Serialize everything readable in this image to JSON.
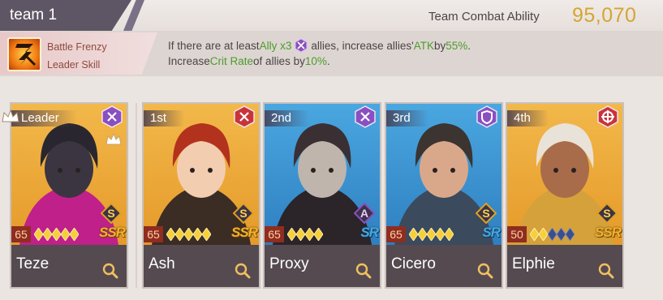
{
  "header": {
    "team_name": "team 1",
    "combat_label": "Team Combat Ability",
    "combat_value": "95,070"
  },
  "leader_skill": {
    "name": "Battle Frenzy",
    "type": "Leader Skill",
    "line1": {
      "prefix": "If there are at least ",
      "ally_count": "Ally x3",
      "middle": " allies, increase allies' ",
      "stat": "ATK",
      "by": " by ",
      "value": "55%",
      "suffix": "."
    },
    "line2": {
      "prefix": "Increase ",
      "stat": "Crit Rate",
      "middle": " of allies by ",
      "value": "10%",
      "suffix": "."
    },
    "ally_icon": "purple-sword-class-icon"
  },
  "heroes": [
    {
      "slot": "Leader",
      "name": "Teze",
      "level": "65",
      "grade": "S",
      "rarity": "SSR",
      "class_icon": "crossed-swords-purple",
      "stars_filled": 5,
      "stars_total": 5,
      "bg_color": "#f2b84a"
    },
    {
      "slot": "1st",
      "name": "Ash",
      "level": "65",
      "grade": "S",
      "rarity": "SSR",
      "class_icon": "crossed-swords-red",
      "stars_filled": 5,
      "stars_total": 5,
      "bg_color": "#f2b84a"
    },
    {
      "slot": "2nd",
      "name": "Proxy",
      "level": "65",
      "grade": "A",
      "rarity": "SR",
      "class_icon": "crossed-swords-purple",
      "stars_filled": 4,
      "stars_total": 4,
      "bg_color": "#4aa7e0"
    },
    {
      "slot": "3rd",
      "name": "Cicero",
      "level": "65",
      "grade": "S",
      "rarity": "SR",
      "class_icon": "shield-purple",
      "stars_filled": 5,
      "stars_total": 5,
      "bg_color": "#4aa7e0"
    },
    {
      "slot": "4th",
      "name": "Elphie",
      "level": "50",
      "grade": "S",
      "rarity": "SSR",
      "class_icon": "cross-red",
      "stars_filled": 2,
      "stars_total": 5,
      "bg_color": "#f2b84a"
    }
  ],
  "colors": {
    "accent_gold": "#d6a431",
    "highlight_green": "#4b9d2c",
    "tab_dark": "#5f5665",
    "name_bar": "#554a50"
  }
}
